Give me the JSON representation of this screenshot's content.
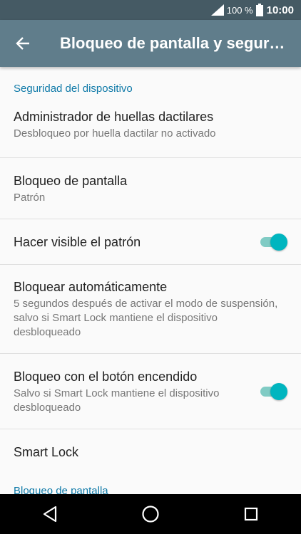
{
  "status_bar": {
    "battery_percent": "100 %",
    "time": "10:00",
    "icons": [
      "signal-icon",
      "battery-icon"
    ]
  },
  "app_bar": {
    "title": "Bloqueo de pantalla y segur…",
    "back_icon": "arrow-left-icon"
  },
  "section": {
    "header": "Seguridad del dispositivo"
  },
  "items": [
    {
      "title": "Administrador de huellas dactilares",
      "summary": "Desbloqueo por huella dactilar no activado"
    },
    {
      "title": "Bloqueo de pantalla",
      "summary": "Patrón"
    },
    {
      "title": "Hacer visible el patrón",
      "toggle": true
    },
    {
      "title": "Bloquear automáticamente",
      "summary": "5 segundos después de activar el modo de suspensión, salvo si Smart Lock mantiene el dispositivo desbloqueado"
    },
    {
      "title": "Bloqueo con el botón encendido",
      "summary": "Salvo si Smart Lock mantiene el dispositivo desbloqueado",
      "toggle": true
    },
    {
      "title": "Smart Lock"
    }
  ],
  "next_section_header_partial": "Bloqueo de pantalla",
  "nav_bar": {
    "icons": [
      "back-triangle-icon",
      "home-circle-icon",
      "recents-square-icon"
    ]
  },
  "colors": {
    "status_bar": "#455a64",
    "app_bar": "#607d8b",
    "accent": "#0f7aa8",
    "toggle_on": "#00b5bf"
  }
}
